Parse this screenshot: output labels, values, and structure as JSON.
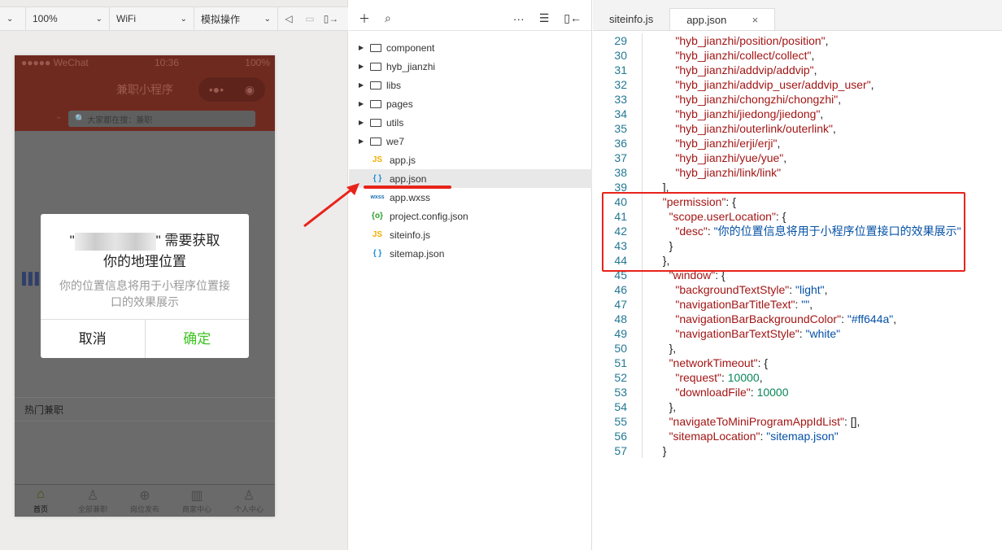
{
  "simulator": {
    "toolbar": {
      "zoom": "100%",
      "network": "WiFi",
      "operation": "模拟操作"
    },
    "phone": {
      "carrier": "●●●●● WeChat",
      "time": "10:36",
      "battery": "100%",
      "nav_title": "兼职小程序",
      "search_placeholder": "大家都在搜：兼职",
      "section_title": "热门兼职",
      "tabs": [
        {
          "label": "首页",
          "icon": "home-icon"
        },
        {
          "label": "全部兼职",
          "icon": "person-icon"
        },
        {
          "label": "岗位发布",
          "icon": "plus-circle-icon"
        },
        {
          "label": "商家中心",
          "icon": "building-icon"
        },
        {
          "label": "个人中心",
          "icon": "user-icon"
        }
      ],
      "dialog": {
        "title_prefix": "\"",
        "title_suffix": "\" 需要获取",
        "title_line2": "你的地理位置",
        "body": "你的位置信息将用于小程序位置接口的效果展示",
        "cancel": "取消",
        "confirm": "确定"
      }
    }
  },
  "tree": {
    "items": [
      {
        "name": "component",
        "type": "folder"
      },
      {
        "name": "hyb_jianzhi",
        "type": "folder"
      },
      {
        "name": "libs",
        "type": "folder"
      },
      {
        "name": "pages",
        "type": "folder"
      },
      {
        "name": "utils",
        "type": "folder"
      },
      {
        "name": "we7",
        "type": "folder"
      },
      {
        "name": "app.js",
        "type": "JS"
      },
      {
        "name": "app.json",
        "type": "{ }"
      },
      {
        "name": "app.wxss",
        "type": "wxss"
      },
      {
        "name": "project.config.json",
        "type": "{o}"
      },
      {
        "name": "siteinfo.js",
        "type": "JS"
      },
      {
        "name": "sitemap.json",
        "type": "{ }"
      }
    ]
  },
  "editor": {
    "tabs": [
      "siteinfo.js",
      "app.json"
    ],
    "close": "×",
    "lines": [
      {
        "n": "29",
        "t": [
          [
            "      ",
            "p"
          ],
          [
            "\"hyb_jianzhi/position/position\"",
            "k"
          ],
          [
            ",",
            "p"
          ]
        ]
      },
      {
        "n": "30",
        "t": [
          [
            "      ",
            "p"
          ],
          [
            "\"hyb_jianzhi/collect/collect\"",
            "k"
          ],
          [
            ",",
            "p"
          ]
        ]
      },
      {
        "n": "31",
        "t": [
          [
            "      ",
            "p"
          ],
          [
            "\"hyb_jianzhi/addvip/addvip\"",
            "k"
          ],
          [
            ",",
            "p"
          ]
        ]
      },
      {
        "n": "32",
        "t": [
          [
            "      ",
            "p"
          ],
          [
            "\"hyb_jianzhi/addvip_user/addvip_user\"",
            "k"
          ],
          [
            ",",
            "p"
          ]
        ]
      },
      {
        "n": "33",
        "t": [
          [
            "      ",
            "p"
          ],
          [
            "\"hyb_jianzhi/chongzhi/chongzhi\"",
            "k"
          ],
          [
            ",",
            "p"
          ]
        ]
      },
      {
        "n": "34",
        "t": [
          [
            "      ",
            "p"
          ],
          [
            "\"hyb_jianzhi/jiedong/jiedong\"",
            "k"
          ],
          [
            ",",
            "p"
          ]
        ]
      },
      {
        "n": "35",
        "t": [
          [
            "      ",
            "p"
          ],
          [
            "\"hyb_jianzhi/outerlink/outerlink\"",
            "k"
          ],
          [
            ",",
            "p"
          ]
        ]
      },
      {
        "n": "36",
        "t": [
          [
            "      ",
            "p"
          ],
          [
            "\"hyb_jianzhi/erji/erji\"",
            "k"
          ],
          [
            ",",
            "p"
          ]
        ]
      },
      {
        "n": "37",
        "t": [
          [
            "      ",
            "p"
          ],
          [
            "\"hyb_jianzhi/yue/yue\"",
            "k"
          ],
          [
            ",",
            "p"
          ]
        ]
      },
      {
        "n": "38",
        "t": [
          [
            "      ",
            "p"
          ],
          [
            "\"hyb_jianzhi/link/link\"",
            "k"
          ]
        ]
      },
      {
        "n": "39",
        "t": [
          [
            "  ",
            "p"
          ],
          [
            "],",
            "p"
          ]
        ]
      },
      {
        "n": "40",
        "t": [
          [
            "  ",
            "p"
          ],
          [
            "\"permission\"",
            "k"
          ],
          [
            ": {",
            "p"
          ]
        ]
      },
      {
        "n": "41",
        "t": [
          [
            "    ",
            "p"
          ],
          [
            "\"scope.userLocation\"",
            "k"
          ],
          [
            ": {",
            "p"
          ]
        ]
      },
      {
        "n": "42",
        "t": [
          [
            "      ",
            "p"
          ],
          [
            "\"desc\"",
            "k"
          ],
          [
            ": ",
            "p"
          ],
          [
            "\"你的位置信息将用于小程序位置接口的效果展示\"",
            "s"
          ]
        ]
      },
      {
        "n": "43",
        "t": [
          [
            "    ",
            "p"
          ],
          [
            "}",
            "p"
          ]
        ]
      },
      {
        "n": "44",
        "t": [
          [
            "  ",
            "p"
          ],
          [
            "},",
            "p"
          ]
        ]
      },
      {
        "n": "45",
        "t": [
          [
            "    ",
            "p"
          ],
          [
            "\"window\"",
            "k"
          ],
          [
            ": {",
            "p"
          ]
        ]
      },
      {
        "n": "46",
        "t": [
          [
            "      ",
            "p"
          ],
          [
            "\"backgroundTextStyle\"",
            "k"
          ],
          [
            ": ",
            "p"
          ],
          [
            "\"light\"",
            "s"
          ],
          [
            ",",
            "p"
          ]
        ]
      },
      {
        "n": "47",
        "t": [
          [
            "      ",
            "p"
          ],
          [
            "\"navigationBarTitleText\"",
            "k"
          ],
          [
            ": ",
            "p"
          ],
          [
            "\"\"",
            "s"
          ],
          [
            ",",
            "p"
          ]
        ]
      },
      {
        "n": "48",
        "t": [
          [
            "      ",
            "p"
          ],
          [
            "\"navigationBarBackgroundColor\"",
            "k"
          ],
          [
            ": ",
            "p"
          ],
          [
            "\"#ff644a\"",
            "s"
          ],
          [
            ",",
            "p"
          ]
        ]
      },
      {
        "n": "49",
        "t": [
          [
            "      ",
            "p"
          ],
          [
            "\"navigationBarTextStyle\"",
            "k"
          ],
          [
            ": ",
            "p"
          ],
          [
            "\"white\"",
            "s"
          ]
        ]
      },
      {
        "n": "50",
        "t": [
          [
            "    ",
            "p"
          ],
          [
            "},",
            "p"
          ]
        ]
      },
      {
        "n": "51",
        "t": [
          [
            "    ",
            "p"
          ],
          [
            "\"networkTimeout\"",
            "k"
          ],
          [
            ": {",
            "p"
          ]
        ]
      },
      {
        "n": "52",
        "t": [
          [
            "      ",
            "p"
          ],
          [
            "\"request\"",
            "k"
          ],
          [
            ": ",
            "p"
          ],
          [
            "10000",
            "n"
          ],
          [
            ",",
            "p"
          ]
        ]
      },
      {
        "n": "53",
        "t": [
          [
            "      ",
            "p"
          ],
          [
            "\"downloadFile\"",
            "k"
          ],
          [
            ": ",
            "p"
          ],
          [
            "10000",
            "n"
          ]
        ]
      },
      {
        "n": "54",
        "t": [
          [
            "    ",
            "p"
          ],
          [
            "},",
            "p"
          ]
        ]
      },
      {
        "n": "55",
        "t": [
          [
            "    ",
            "p"
          ],
          [
            "\"navigateToMiniProgramAppIdList\"",
            "k"
          ],
          [
            ": [],",
            "p"
          ]
        ]
      },
      {
        "n": "56",
        "t": [
          [
            "    ",
            "p"
          ],
          [
            "\"sitemapLocation\"",
            "k"
          ],
          [
            ": ",
            "p"
          ],
          [
            "\"sitemap.json\"",
            "s"
          ]
        ]
      },
      {
        "n": "57",
        "t": [
          [
            "  ",
            "p"
          ],
          [
            "}",
            "p"
          ]
        ]
      }
    ]
  },
  "colors": {
    "highlight": "#e8231b",
    "confirm": "#3cc51f",
    "nav_bg": "#ff644a"
  }
}
